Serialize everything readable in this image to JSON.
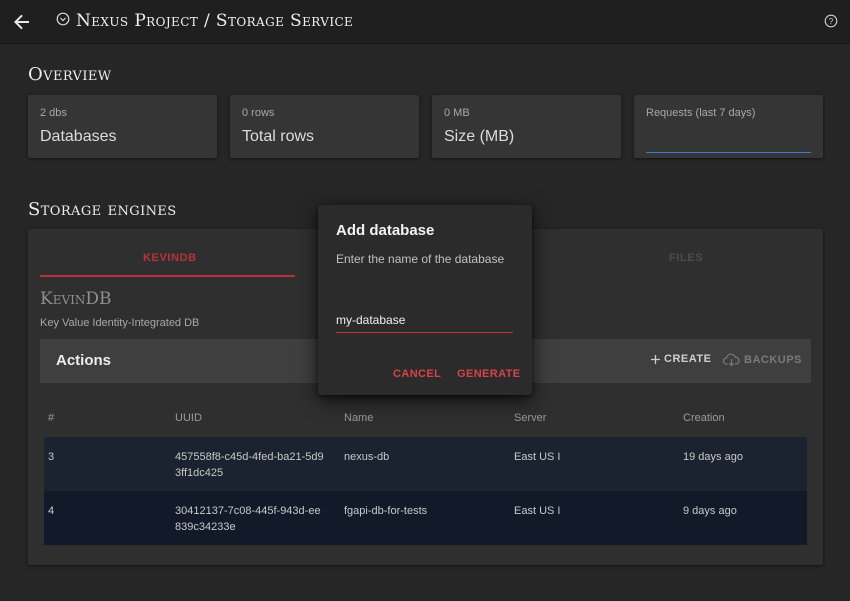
{
  "header": {
    "title": "Nexus Project / Storage Service",
    "back_icon": "arrow-left-icon",
    "project_icon": "chevron-circle-icon",
    "help_icon": "help-circle-icon"
  },
  "overview": {
    "title": "Overview",
    "cards": [
      {
        "sub": "2 dbs",
        "value": "Databases"
      },
      {
        "sub": "0 rows",
        "value": "Total rows"
      },
      {
        "sub": "0 MB",
        "value": "Size (MB)"
      },
      {
        "sub": "Requests (last 7 days)",
        "value": ""
      }
    ]
  },
  "storage": {
    "title": "Storage engines",
    "tabs": [
      {
        "label": "KEVINDB",
        "active": true
      },
      {
        "label": "FILES",
        "active": false
      }
    ],
    "engine_name": "KevinDB",
    "engine_desc": "Key Value Identity-Integrated DB",
    "actions": {
      "label": "Actions",
      "create": "CREATE",
      "backups": "BACKUPS"
    },
    "table": {
      "columns": [
        "#",
        "UUID",
        "Name",
        "Server",
        "Creation"
      ],
      "rows": [
        {
          "num": "3",
          "uuid": "457558f8-c45d-4fed-ba21-5d93ff1dc425",
          "name": "nexus-db",
          "server": "East US I",
          "creation": "19 days ago"
        },
        {
          "num": "4",
          "uuid": "30412137-7c08-445f-943d-ee839c34233e",
          "name": "fgapi-db-for-tests",
          "server": "East US I",
          "creation": "9 days ago"
        }
      ]
    }
  },
  "dialog": {
    "title": "Add database",
    "text": "Enter the name of the database",
    "input_value": "my-database",
    "cancel": "CANCEL",
    "generate": "GENERATE"
  },
  "colors": {
    "accent": "#b8323c",
    "dialog_button": "#d8434b",
    "row_1": "#1b2230",
    "row_2": "#121a2a",
    "requests_line": "#3a7bd5"
  }
}
